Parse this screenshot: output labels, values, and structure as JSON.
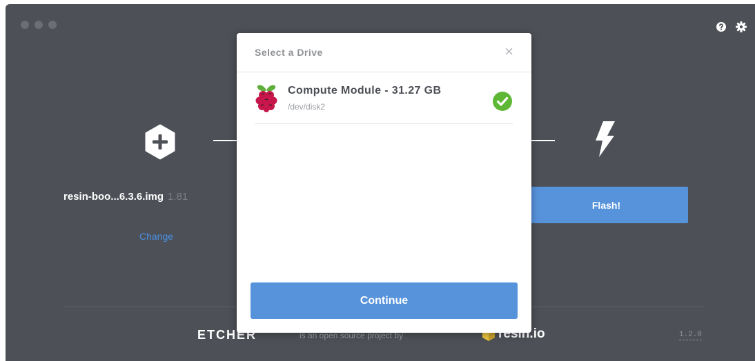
{
  "window": {
    "colors": {
      "background": "#4d5057",
      "accent": "#5793db",
      "link": "#4a90e2"
    }
  },
  "toolbar": {
    "help_icon": "question-circle-icon",
    "settings_icon": "gear-icon"
  },
  "steps": {
    "select_image": {
      "icon": "plus-hexagon-icon",
      "image_name": "resin-boo...6.3.6.img",
      "image_size": "1.81",
      "change_label": "Change"
    },
    "flash": {
      "icon": "lightning-bolt-icon",
      "button_label": "Flash!"
    }
  },
  "modal": {
    "title": "Select a Drive",
    "close_glyph": "×",
    "drives": [
      {
        "name": "Compute Module - 31.27 GB",
        "path": "/dev/disk2",
        "icon": "raspberry-pi-icon",
        "selected": true
      }
    ],
    "continue_label": "Continue"
  },
  "footer": {
    "logo_text": "ETCHER",
    "tagline": "is an open source project by",
    "company": "resin.io",
    "version": "1.2.0"
  }
}
